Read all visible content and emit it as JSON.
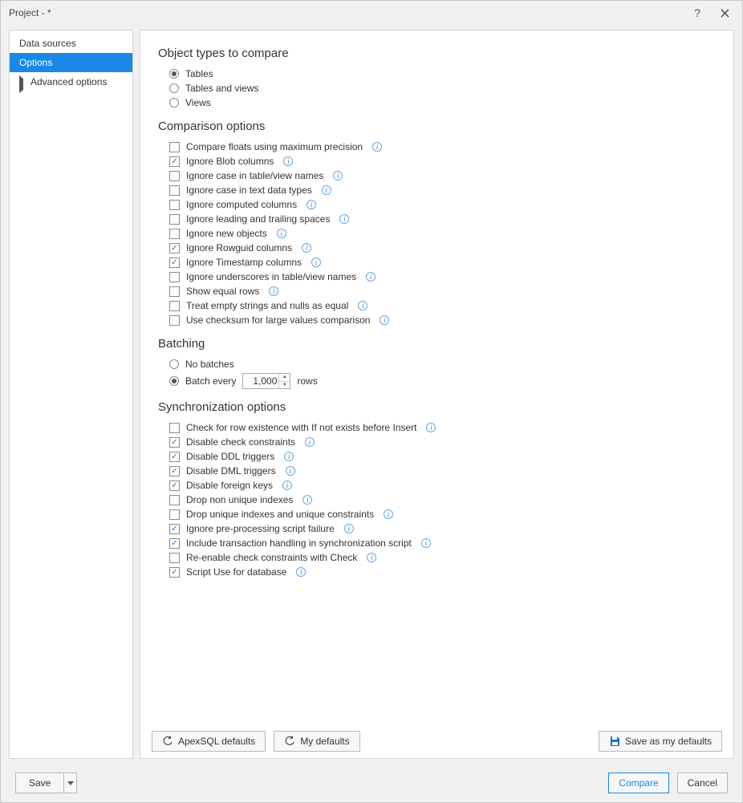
{
  "window": {
    "title": "Project - *"
  },
  "sidebar": {
    "items": [
      {
        "label": "Data sources"
      },
      {
        "label": "Options"
      },
      {
        "label": "Advanced options"
      }
    ]
  },
  "sections": {
    "object_types": {
      "heading": "Object types to compare",
      "options": [
        {
          "label": "Tables",
          "selected": true
        },
        {
          "label": "Tables and views",
          "selected": false
        },
        {
          "label": "Views",
          "selected": false
        }
      ]
    },
    "comparison": {
      "heading": "Comparison options",
      "options": [
        {
          "label": "Compare floats using maximum precision",
          "checked": false,
          "info": true
        },
        {
          "label": "Ignore Blob columns",
          "checked": true,
          "info": true
        },
        {
          "label": "Ignore case in table/view names",
          "checked": false,
          "info": true
        },
        {
          "label": "Ignore case in text data types",
          "checked": false,
          "info": true
        },
        {
          "label": "Ignore computed columns",
          "checked": false,
          "info": true
        },
        {
          "label": "Ignore leading and trailing spaces",
          "checked": false,
          "info": true
        },
        {
          "label": "Ignore new objects",
          "checked": false,
          "info": true
        },
        {
          "label": "Ignore Rowguid columns",
          "checked": true,
          "info": true
        },
        {
          "label": "Ignore Timestamp columns",
          "checked": true,
          "info": true
        },
        {
          "label": "Ignore underscores in table/view names",
          "checked": false,
          "info": true
        },
        {
          "label": "Show equal rows",
          "checked": false,
          "info": true
        },
        {
          "label": "Treat empty strings and nulls as equal",
          "checked": false,
          "info": true
        },
        {
          "label": "Use checksum for large values comparison",
          "checked": false,
          "info": true
        }
      ]
    },
    "batching": {
      "heading": "Batching",
      "options": [
        {
          "label": "No batches",
          "selected": false
        },
        {
          "label": "Batch every",
          "selected": true
        }
      ],
      "batch_value": "1,000",
      "rows_suffix": "rows"
    },
    "sync": {
      "heading": "Synchronization options",
      "options": [
        {
          "label": "Check for row existence with If not exists before Insert",
          "checked": false,
          "info": true
        },
        {
          "label": "Disable check constraints",
          "checked": true,
          "info": true
        },
        {
          "label": "Disable DDL triggers",
          "checked": true,
          "info": true
        },
        {
          "label": "Disable DML triggers",
          "checked": true,
          "info": true
        },
        {
          "label": "Disable foreign keys",
          "checked": true,
          "info": true
        },
        {
          "label": "Drop non unique indexes",
          "checked": false,
          "info": true
        },
        {
          "label": "Drop unique indexes and unique constraints",
          "checked": false,
          "info": true
        },
        {
          "label": "Ignore pre-processing script failure",
          "checked": true,
          "info": true
        },
        {
          "label": "Include transaction handling in synchronization script",
          "checked": true,
          "info": true
        },
        {
          "label": "Re-enable check constraints with Check",
          "checked": false,
          "info": true
        },
        {
          "label": "Script Use for database",
          "checked": true,
          "info": true
        }
      ]
    }
  },
  "buttons": {
    "apex_defaults": "ApexSQL defaults",
    "my_defaults": "My defaults",
    "save_defaults": "Save as my defaults",
    "save": "Save",
    "compare": "Compare",
    "cancel": "Cancel"
  }
}
